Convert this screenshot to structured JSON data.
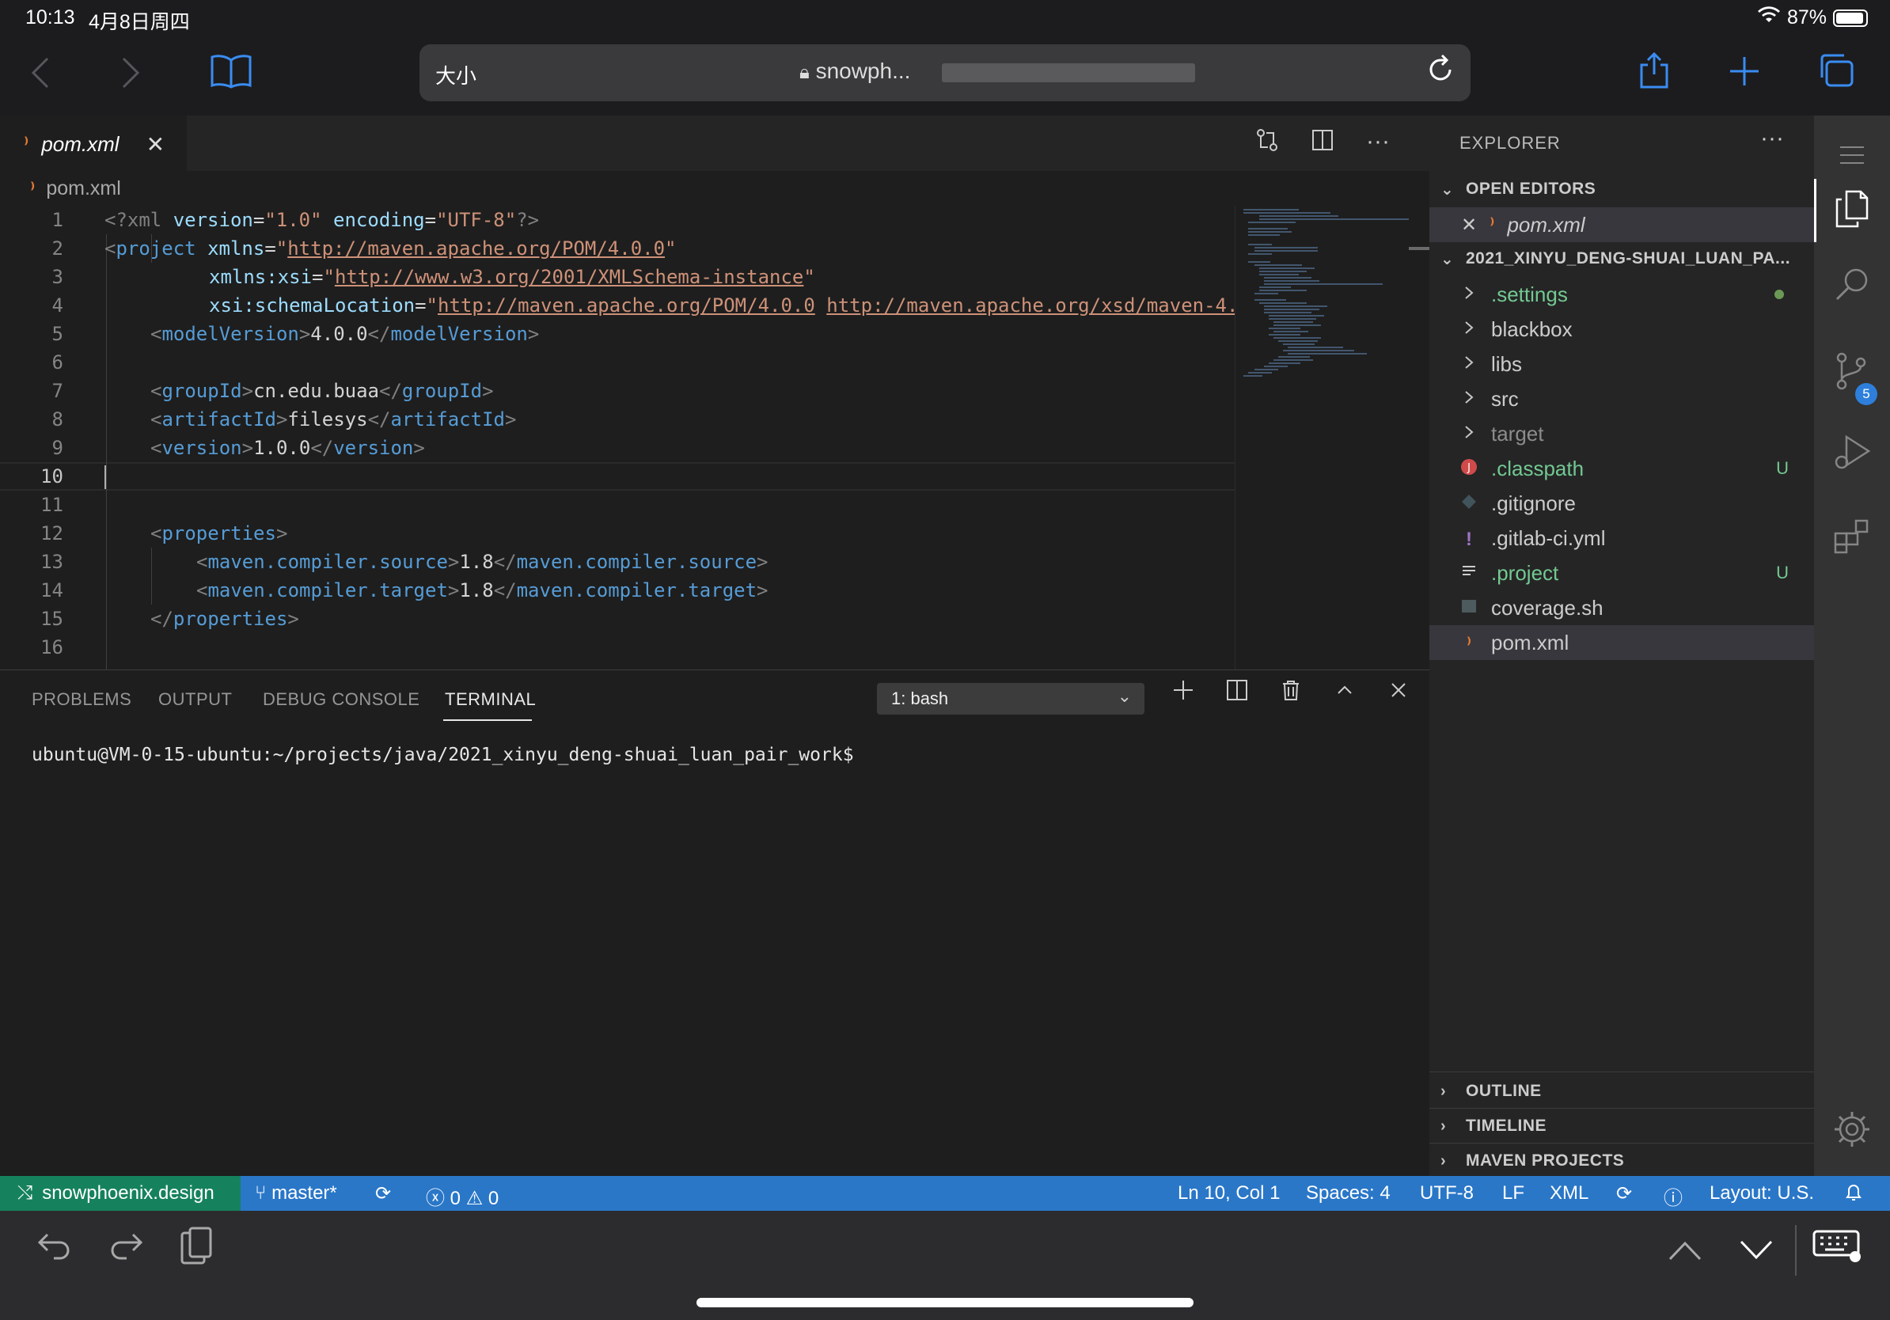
{
  "ios": {
    "time": "10:13",
    "date": "4月8日周四",
    "battery": "87%",
    "url_size_label": "大小",
    "url_text": "snowph..."
  },
  "editor": {
    "tab_label": "pom.xml",
    "breadcrumb": "pom.xml"
  },
  "code_lines": [
    {
      "n": "1"
    },
    {
      "n": "2"
    },
    {
      "n": "3"
    },
    {
      "n": "4"
    },
    {
      "n": "5"
    },
    {
      "n": "6"
    },
    {
      "n": "7"
    },
    {
      "n": "8"
    },
    {
      "n": "9"
    },
    {
      "n": "10"
    },
    {
      "n": "11"
    },
    {
      "n": "12"
    },
    {
      "n": "13"
    },
    {
      "n": "14"
    },
    {
      "n": "15"
    },
    {
      "n": "16"
    }
  ],
  "code": {
    "l1": {
      "open": "<?xml ",
      "a1": "version",
      "eq1": "=",
      "v1": "\"1.0\"",
      "sp": " ",
      "a2": "encoding",
      "eq2": "=",
      "v2": "\"UTF-8\"",
      "close": "?>"
    },
    "l2": {
      "lt": "<",
      "tag": "project",
      "sp": " ",
      "attr": "xmlns",
      "eq": "=",
      "q1": "\"",
      "url": "http://maven.apache.org/POM/4.0.0",
      "q2": "\""
    },
    "l3": {
      "attr": "xmlns:xsi",
      "eq": "=",
      "q1": "\"",
      "url": "http://www.w3.org/2001/XMLSchema-instance",
      "q2": "\""
    },
    "l4": {
      "attr": "xsi:schemaLocation",
      "eq": "=",
      "q1": "\"",
      "url1": "http://maven.apache.org/POM/4.0.0",
      "sp": " ",
      "url2": "http://maven.apache.org/xsd/maven-4."
    },
    "l5": {
      "tag": "modelVersion",
      "val": "4.0.0"
    },
    "l7": {
      "tag": "groupId",
      "val": "cn.edu.buaa"
    },
    "l8": {
      "tag": "artifactId",
      "val": "filesys"
    },
    "l9": {
      "tag": "version",
      "val": "1.0.0"
    },
    "l12": {
      "tag": "properties"
    },
    "l13": {
      "tag": "maven.compiler.source",
      "val": "1.8"
    },
    "l14": {
      "tag": "maven.compiler.target",
      "val": "1.8"
    },
    "l15": {
      "tag": "properties"
    }
  },
  "panel": {
    "tabs": [
      "PROBLEMS",
      "OUTPUT",
      "DEBUG CONSOLE",
      "TERMINAL"
    ],
    "terminal_select": "1: bash",
    "prompt": "ubuntu@VM-0-15-ubuntu:~/projects/java/2021_xinyu_deng-shuai_luan_pair_work$"
  },
  "explorer": {
    "title": "EXPLORER",
    "open_editors_label": "OPEN EDITORS",
    "open_editor_file": "pom.xml",
    "project_label": "2021_XINYU_DENG-SHUAI_LUAN_PA...",
    "tree": [
      {
        "name": ".settings",
        "type": "folder",
        "color": "#73c991",
        "status": "dot"
      },
      {
        "name": "blackbox",
        "type": "folder",
        "color": "#cccccc",
        "status": ""
      },
      {
        "name": "libs",
        "type": "folder",
        "color": "#cccccc",
        "status": ""
      },
      {
        "name": "src",
        "type": "folder",
        "color": "#cccccc",
        "status": ""
      },
      {
        "name": "target",
        "type": "folder",
        "color": "#8c8c8c",
        "status": ""
      },
      {
        "name": ".classpath",
        "type": "file",
        "icon": "java-icon",
        "color": "#73c991",
        "status": "U"
      },
      {
        "name": ".gitignore",
        "type": "file",
        "icon": "git-icon",
        "color": "#cccccc",
        "status": ""
      },
      {
        "name": ".gitlab-ci.yml",
        "type": "file",
        "icon": "yaml-icon",
        "color": "#cccccc",
        "status": ""
      },
      {
        "name": ".project",
        "type": "file",
        "icon": "lines-icon",
        "color": "#73c991",
        "status": "U"
      },
      {
        "name": "coverage.sh",
        "type": "file",
        "icon": "shell-icon",
        "color": "#cccccc",
        "status": ""
      },
      {
        "name": "pom.xml",
        "type": "file",
        "icon": "rss-icon",
        "color": "#cccccc",
        "status": ""
      }
    ],
    "outline_label": "OUTLINE",
    "timeline_label": "TIMELINE",
    "maven_label": "MAVEN PROJECTS"
  },
  "activity": {
    "scm_badge": "5"
  },
  "statusbar": {
    "remote": "snowphoenix.design",
    "branch": "master*",
    "errors": "0",
    "warnings": "0",
    "position": "Ln 10, Col 1",
    "spaces": "Spaces: 4",
    "encoding": "UTF-8",
    "eol": "LF",
    "language": "XML",
    "layout": "Layout: U.S."
  },
  "colors": {
    "status_blue": "#2a77c8",
    "remote_green": "#16825d",
    "ios_accent": "#3a8cf2",
    "untracked_green": "#73c991"
  }
}
